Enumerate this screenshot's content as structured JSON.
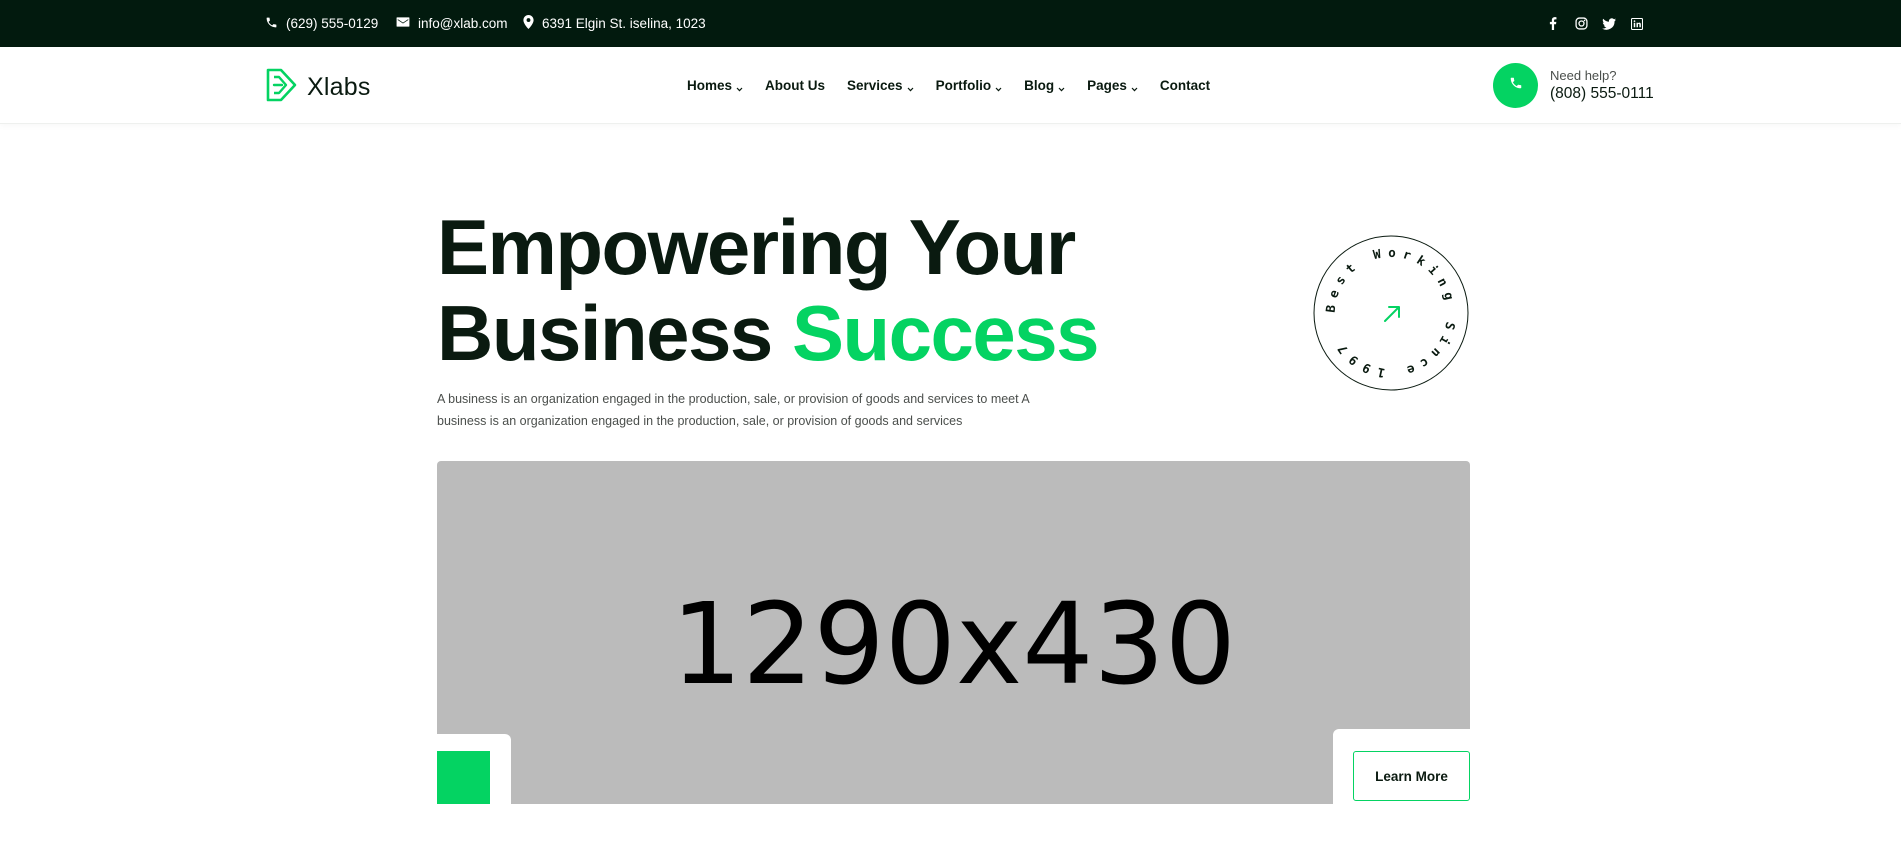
{
  "topbar": {
    "phone": "(629) 555-0129",
    "email": "info@xlab.com",
    "address": "6391 Elgin St. iselina, 1023",
    "socials": [
      "facebook-icon",
      "instagram-icon",
      "twitter-icon",
      "linkedin-icon"
    ]
  },
  "header": {
    "logo_text": "Xlabs",
    "nav": [
      {
        "label": "Homes",
        "dropdown": true
      },
      {
        "label": "About Us",
        "dropdown": false
      },
      {
        "label": "Services",
        "dropdown": true
      },
      {
        "label": "Portfolio",
        "dropdown": true
      },
      {
        "label": "Blog",
        "dropdown": true
      },
      {
        "label": "Pages",
        "dropdown": true
      },
      {
        "label": "Contact",
        "dropdown": false
      }
    ],
    "help_label": "Need help?",
    "help_phone": "(808) 555-0111"
  },
  "hero": {
    "title_line1": "Empowering Your",
    "title_line2_plain": "Business ",
    "title_line2_accent": "Success",
    "description": "A business is an organization engaged in the production, sale, or provision of goods and services to meet A business is an organization engaged in the production, sale, or provision of goods and services",
    "badge_text": "Best Working Since 1997",
    "image_placeholder": "1290x430",
    "cta_label": "Learn More"
  },
  "colors": {
    "accent": "#04d362",
    "topbar_bg": "#021a0e",
    "text_dark": "#0a1a10",
    "placeholder_bg": "#bbbbbb"
  }
}
